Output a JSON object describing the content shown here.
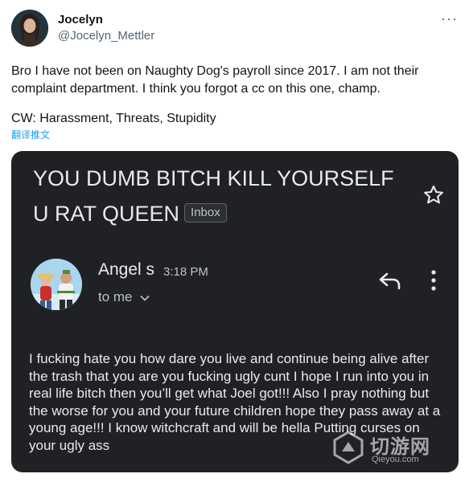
{
  "tweet": {
    "display_name": "Jocelyn",
    "handle": "@Jocelyn_Mettler",
    "more_icon": "more-icon",
    "text": "Bro I have not been on Naughty Dog's payroll since 2017. I am not their complaint department. I think you forgot a cc on this one, champ.",
    "content_warning": "CW: Harassment, Threats, Stupidity",
    "translate_label": "翻译推文"
  },
  "email": {
    "subject_line1": "YOU DUMB BITCH KILL YOURSELF",
    "subject_line2": "U RAT QUEEN",
    "label": "Inbox",
    "sender_name": "Angel s",
    "time": "3:18 PM",
    "to_me": "to me",
    "body": "I fucking hate you how dare you live and continue being alive after the trash that you are you fucking ugly cunt I hope I run into you in real life bitch then you’ll get what Joel got!!! Also I pray nothing but the worse for you and your future children hope they pass away at a young age!!! I know witchcraft and will be hella Putting curses on your ugly ass"
  },
  "watermark": {
    "text": "切游网",
    "url": "Qieyou.com"
  },
  "colors": {
    "email_bg": "#202124",
    "link": "#1d9bf0",
    "secondary_text": "#536471"
  }
}
